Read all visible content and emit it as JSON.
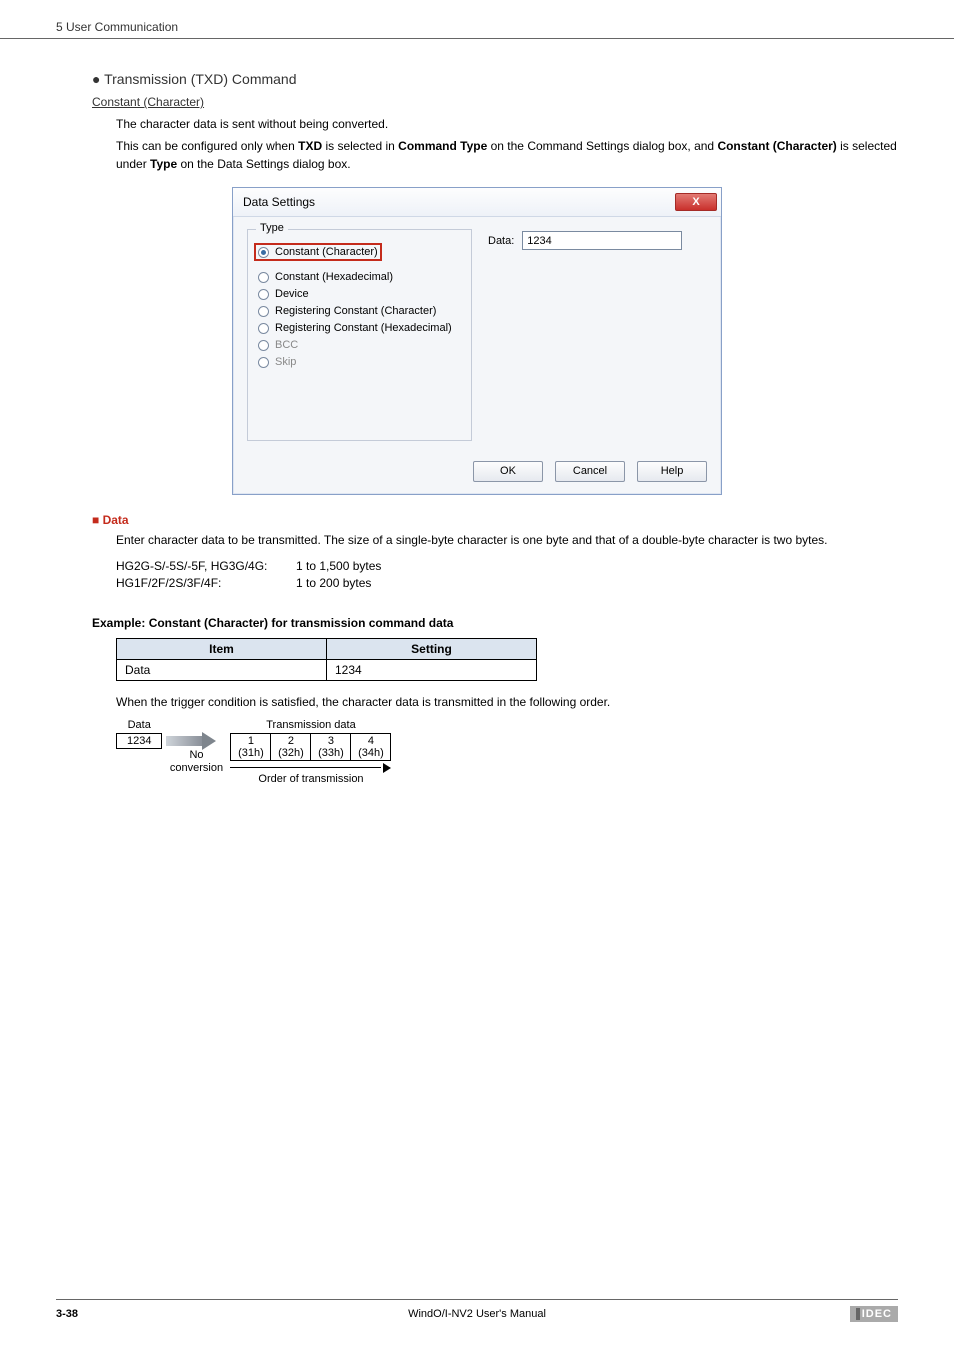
{
  "header": {
    "chapter": "5 User Communication"
  },
  "section": {
    "bullet_heading": "● Transmission (TXD) Command",
    "constant_heading": "Constant (Character)",
    "line1": "The character data is sent without being converted.",
    "line2_pre": "This can be configured only when ",
    "line2_b1": "TXD",
    "line2_mid1": " is selected in ",
    "line2_b2": "Command Type",
    "line2_mid2": " on the Command Settings dialog box, and ",
    "line2_b3": "Constant (Character)",
    "line2_mid3": " is selected under ",
    "line2_b4": "Type",
    "line2_end": " on the Data Settings dialog box."
  },
  "dialog": {
    "title": "Data Settings",
    "close": "X",
    "type_legend": "Type",
    "radios": {
      "constant_char": "Constant (Character)",
      "constant_hex": "Constant (Hexadecimal)",
      "device": "Device",
      "reg_char": "Registering Constant (Character)",
      "reg_hex": "Registering Constant (Hexadecimal)",
      "bcc": "BCC",
      "skip": "Skip"
    },
    "data_label": "Data:",
    "data_value": "1234",
    "buttons": {
      "ok": "OK",
      "cancel": "Cancel",
      "help": "Help"
    }
  },
  "data_section": {
    "heading": "■ Data",
    "desc": "Enter character data to be transmitted. The size of a single-byte character is one byte and that of a double-byte character is two bytes.",
    "spec1_k": "HG2G-S/-5S/-5F, HG3G/4G:",
    "spec1_v": "1 to 1,500 bytes",
    "spec2_k": "HG1F/2F/2S/3F/4F:",
    "spec2_v": "1 to 200 bytes"
  },
  "example": {
    "heading": "Example: Constant (Character) for transmission command data",
    "th_item": "Item",
    "th_setting": "Setting",
    "row_item": "Data",
    "row_setting": "1234",
    "trigger_text": "When the trigger condition is satisfied, the character data is transmitted in the following order.",
    "data_label": "Data",
    "data_value": "1234",
    "noconv1": "No",
    "noconv2": "conversion",
    "trans_title": "Transmission data",
    "bytes": [
      {
        "n": "1",
        "h": "(31h)"
      },
      {
        "n": "2",
        "h": "(32h)"
      },
      {
        "n": "3",
        "h": "(33h)"
      },
      {
        "n": "4",
        "h": "(34h)"
      }
    ],
    "order_label": "Order of transmission"
  },
  "footer": {
    "page": "3-38",
    "manual": "WindO/I-NV2 User's Manual",
    "brand": "IDEC"
  }
}
